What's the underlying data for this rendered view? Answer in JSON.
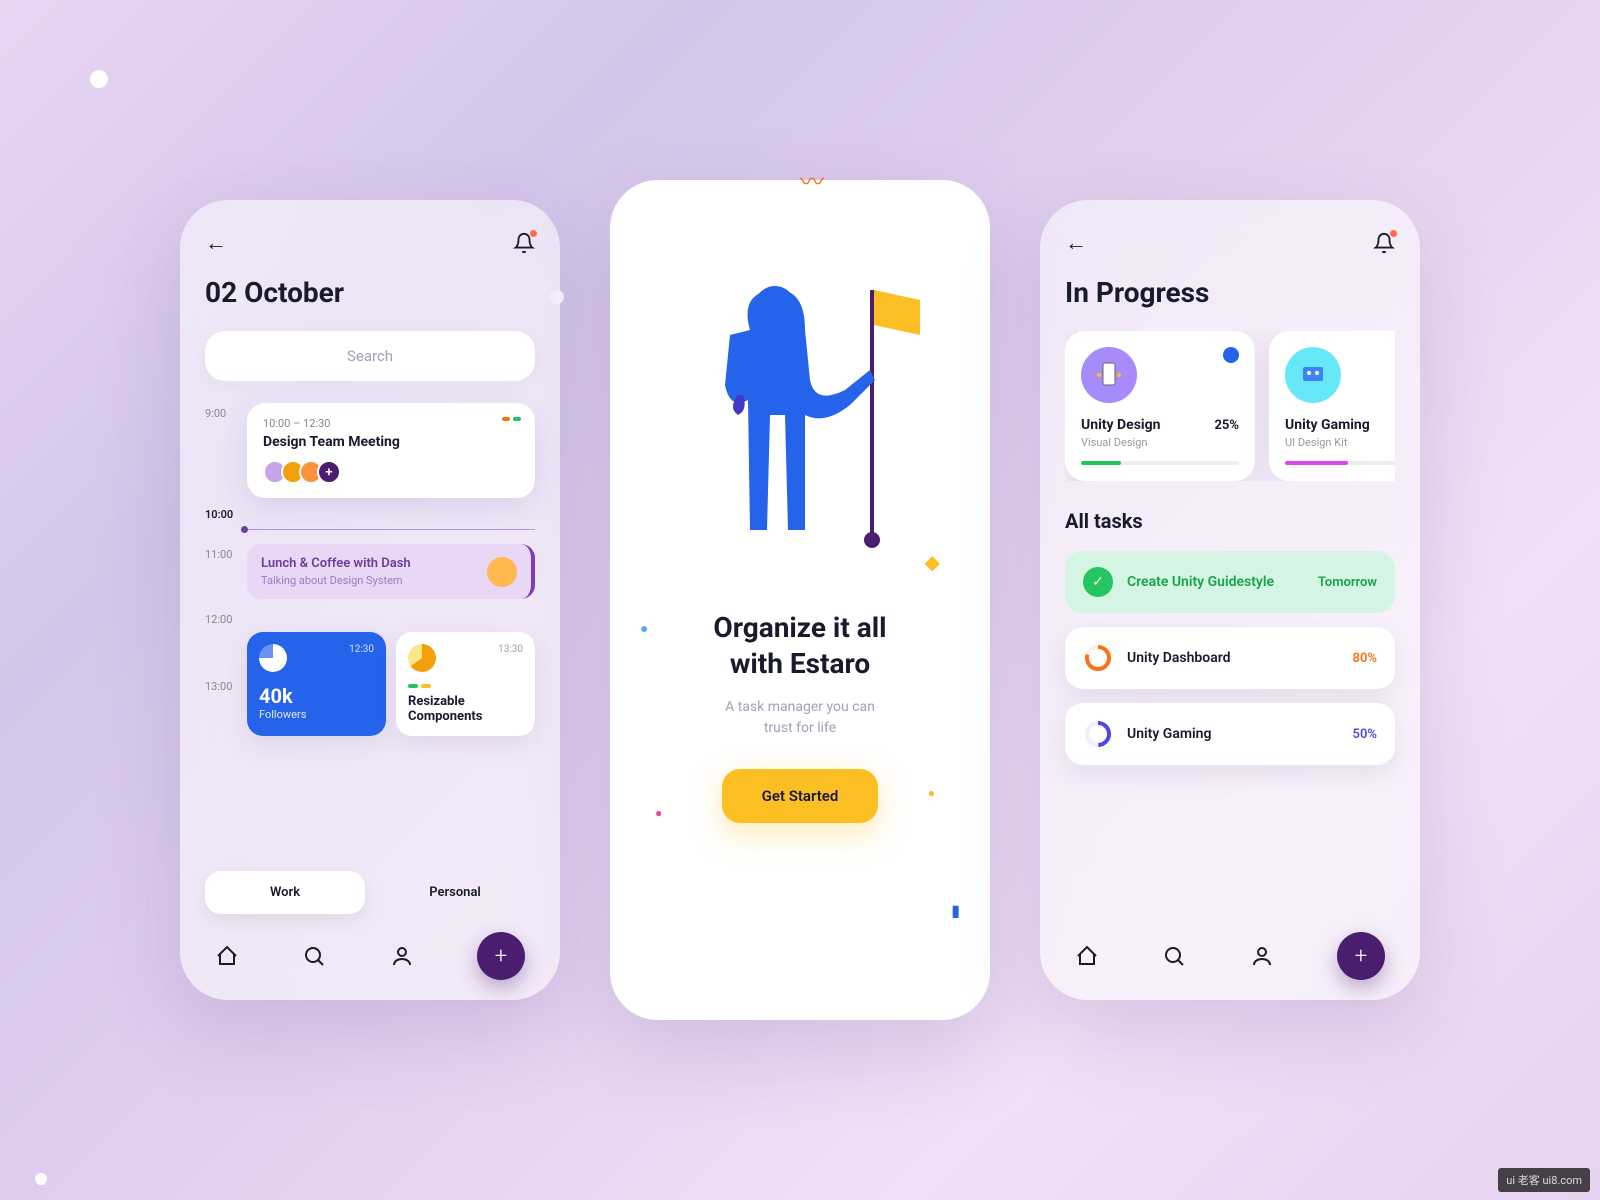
{
  "screen1": {
    "date_title": "02 October",
    "search_placeholder": "Search",
    "times": [
      "9:00",
      "10:00",
      "11:00",
      "12:00",
      "13:00"
    ],
    "event1": {
      "time": "10:00 – 12:30",
      "title": "Design Team Meeting"
    },
    "event2": {
      "title": "Lunch & Coffee with Dash",
      "subtitle": "Talking about Design System"
    },
    "stat1": {
      "time": "12:30",
      "value": "40k",
      "label": "Followers"
    },
    "stat2": {
      "time": "13:30",
      "label": "Resizable Components"
    },
    "tabs": {
      "work": "Work",
      "personal": "Personal"
    }
  },
  "screen2": {
    "headline1": "Organize it all",
    "headline2": "with Estaro",
    "sub1": "A task manager you can",
    "sub2": "trust for life",
    "cta": "Get Started"
  },
  "screen3": {
    "title": "In Progress",
    "cards": [
      {
        "name": "Unity Design",
        "pct": "25%",
        "sub": "Visual Design",
        "bar_pct": 25,
        "color": "#22c55e"
      },
      {
        "name": "Unity Gaming",
        "pct": "",
        "sub": "UI Design Kit",
        "bar_pct": 40,
        "color": "#d946ef"
      }
    ],
    "all_tasks_title": "All tasks",
    "tasks": [
      {
        "name": "Create Unity Guidestyle",
        "badge": "Tomorrow",
        "type": "done",
        "color": "#16a34a"
      },
      {
        "name": "Unity Dashboard",
        "badge": "80%",
        "type": "ring",
        "color": "#f97316"
      },
      {
        "name": "Unity Gaming",
        "badge": "50%",
        "type": "ring",
        "color": "#4f46e5"
      }
    ]
  },
  "watermark": "ui 老客\nui8.com"
}
